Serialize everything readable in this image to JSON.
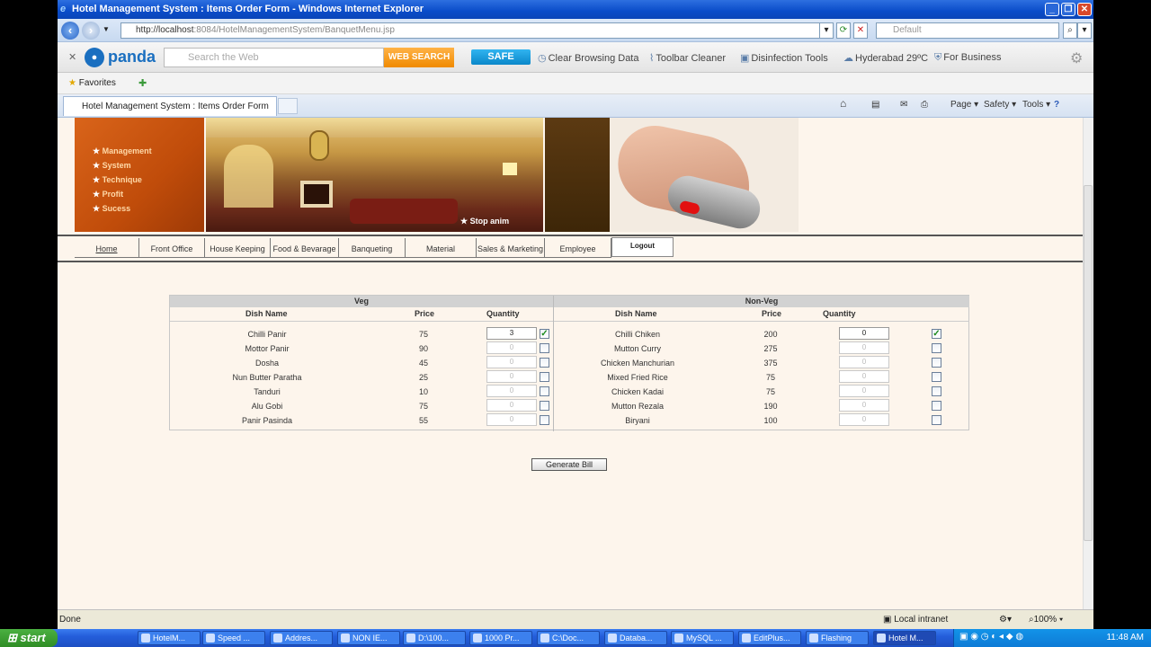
{
  "window": {
    "title": "Hotel Management System : Items Order Form - Windows Internet Explorer",
    "ie_logo": "e",
    "controls": [
      "_",
      "❐",
      "✕"
    ]
  },
  "address": {
    "url_host": "http://localhost",
    "url_path": ":8084/HotelManagementSystem/BanquetMenu.jsp",
    "search_placeholder": "Default"
  },
  "panda": {
    "logo": "panda",
    "search_placeholder": "Search the Web",
    "web_search": "WEB SEARCH",
    "safe": "SAFE",
    "tools": [
      "Clear Browsing Data",
      "Toolbar Cleaner",
      "Disinfection Tools",
      "Hyderabad 29ºC",
      "For Business"
    ]
  },
  "favorites": {
    "label": "Favorites"
  },
  "tab": {
    "title": "Hotel Management System : Items Order Form"
  },
  "commands": {
    "page": "Page ▾",
    "safety": "Safety ▾",
    "tools": "Tools ▾"
  },
  "banner": {
    "menu_items": [
      "Management",
      "System",
      "Technique",
      "Profit",
      "Sucess"
    ],
    "stop_animation": "★ Stop anim"
  },
  "nav": {
    "items": [
      "Home",
      "Front Office",
      "House Keeping",
      "Food & Bevarage",
      "Banqueting",
      "Material",
      "Sales & Marketing",
      "Employee"
    ],
    "logout": "Logout"
  },
  "menu": {
    "veg_title": "Veg",
    "nonveg_title": "Non-Veg",
    "headers": {
      "dish": "Dish Name",
      "price": "Price",
      "quantity": "Quantity"
    },
    "veg": [
      {
        "name": "Chilli Panir",
        "price": "75",
        "qty": "3",
        "checked": true
      },
      {
        "name": "Mottor Panir",
        "price": "90",
        "qty": "0",
        "checked": false
      },
      {
        "name": "Dosha",
        "price": "45",
        "qty": "0",
        "checked": false
      },
      {
        "name": "Nun Butter Paratha",
        "price": "25",
        "qty": "0",
        "checked": false
      },
      {
        "name": "Tanduri",
        "price": "10",
        "qty": "0",
        "checked": false
      },
      {
        "name": "Alu Gobi",
        "price": "75",
        "qty": "0",
        "checked": false
      },
      {
        "name": "Panir Pasinda",
        "price": "55",
        "qty": "0",
        "checked": false
      }
    ],
    "nonveg": [
      {
        "name": "Chilli Chiken",
        "price": "200",
        "qty": "0",
        "checked": true
      },
      {
        "name": "Mutton Curry",
        "price": "275",
        "qty": "0",
        "checked": false
      },
      {
        "name": "Chicken Manchurian",
        "price": "375",
        "qty": "0",
        "checked": false
      },
      {
        "name": "Mixed Fried Rice",
        "price": "75",
        "qty": "0",
        "checked": false
      },
      {
        "name": "Chicken Kadai",
        "price": "75",
        "qty": "0",
        "checked": false
      },
      {
        "name": "Mutton Rezala",
        "price": "190",
        "qty": "0",
        "checked": false
      },
      {
        "name": "Biryani",
        "price": "100",
        "qty": "0",
        "checked": false
      }
    ],
    "generate_bill": "Generate Bill"
  },
  "status": {
    "left": "Done",
    "zone": "Local intranet",
    "zoom": "100%"
  },
  "taskbar": {
    "start": "start",
    "tasks": [
      "HotelM...",
      "Speed ...",
      "Addres...",
      "NON IE...",
      "D:\\100...",
      "1000 Pr...",
      "C:\\Doc...",
      "Databa...",
      "MySQL ...",
      "EditPlus...",
      "Flashing",
      "Hotel M..."
    ],
    "clock": "11:48 AM"
  },
  "colors": {
    "accent_orange": "#c04c0a",
    "ie_blue": "#0a4cc9",
    "page_bg": "#fdf5ec"
  }
}
